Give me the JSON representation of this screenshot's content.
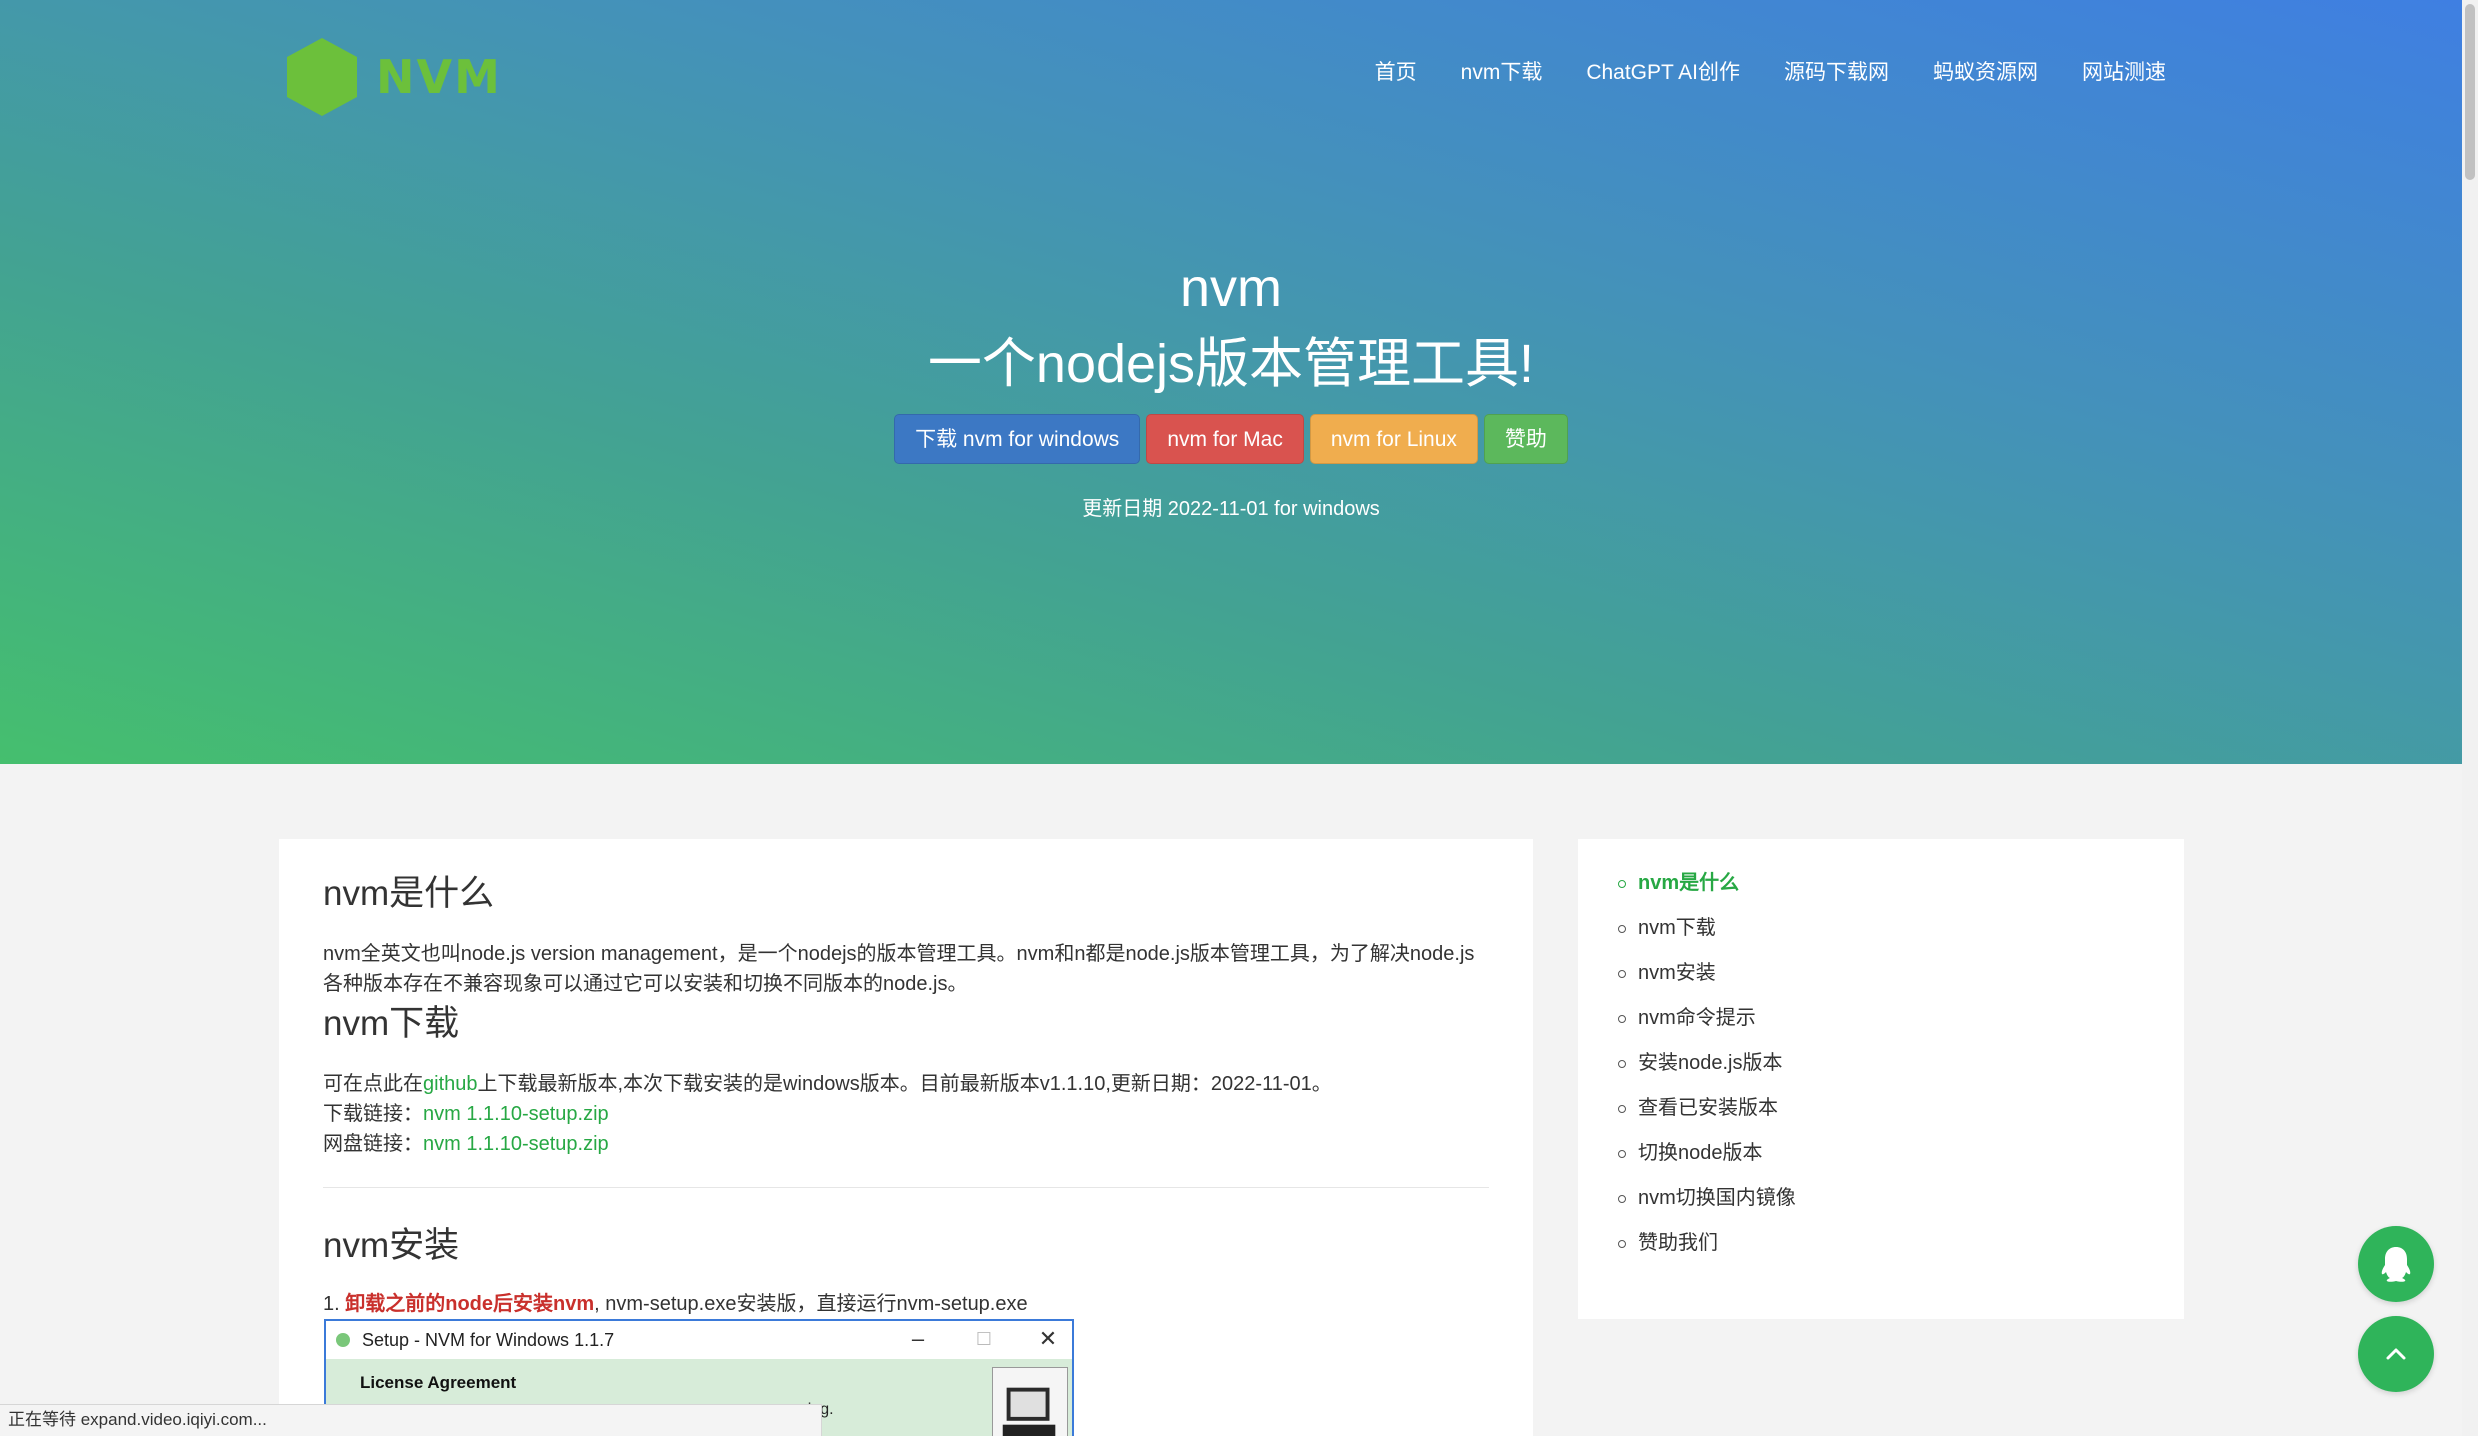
{
  "brand": {
    "name": "NVM",
    "logo_color": "#6cc03b"
  },
  "nav": [
    {
      "label": "首页"
    },
    {
      "label": "nvm下载"
    },
    {
      "label": "ChatGPT AI创作"
    },
    {
      "label": "源码下载网"
    },
    {
      "label": "蚂蚁资源网"
    },
    {
      "label": "网站测速"
    }
  ],
  "hero": {
    "title_line1": "nvm",
    "title_line2": "一个nodejs版本管理工具!",
    "buttons": {
      "windows": "下载 nvm for windows",
      "mac": "nvm for Mac",
      "linux": "nvm for Linux",
      "donate": "赞助"
    },
    "update": "更新日期 2022-11-01  for windows"
  },
  "content": {
    "what": {
      "heading": "nvm是什么",
      "text": "nvm全英文也叫node.js version management，是一个nodejs的版本管理工具。nvm和n都是node.js版本管理工具，为了解决node.js各种版本存在不兼容现象可以通过它可以安装和切换不同版本的node.js。"
    },
    "download": {
      "heading": "nvm下载",
      "line1_pre": "可在点此在",
      "line1_link": "github",
      "line1_post": "上下载最新版本,本次下载安装的是windows版本。目前最新版本v1.1.10,更新日期：2022-11-01。",
      "line2_label": "下载链接：",
      "line2_link": "nvm 1.1.10-setup.zip",
      "line3_label": "网盘链接：",
      "line3_link": "nvm 1.1.10-setup.zip"
    },
    "install": {
      "heading": "nvm安装",
      "step_num": "1. ",
      "step_bold": "卸载之前的node后安装nvm",
      "step_rest": ", nvm-setup.exe安装版，直接运行nvm-setup.exe"
    },
    "setup_window": {
      "title": "Setup - NVM for Windows 1.1.7",
      "heading": "License Agreement",
      "subtext": "nuing."
    }
  },
  "sidebar": {
    "items": [
      {
        "label": "nvm是什么"
      },
      {
        "label": "nvm下载"
      },
      {
        "label": "nvm安装"
      },
      {
        "label": "nvm命令提示"
      },
      {
        "label": "安装node.js版本"
      },
      {
        "label": "查看已安装版本"
      },
      {
        "label": "切换node版本"
      },
      {
        "label": "nvm切换国内镜像"
      },
      {
        "label": "赞助我们"
      }
    ]
  },
  "floating": {
    "qq_icon": "qq-icon",
    "top_icon": "chevron-up-icon"
  },
  "statusbar": {
    "text": "正在等待 expand.video.iqiyi.com..."
  },
  "colors": {
    "accent_green": "#27a844",
    "btn_windows": "#3c78c4",
    "btn_mac": "#d9534f",
    "btn_linux": "#f0ad4e",
    "btn_donate": "#5cb85c"
  }
}
